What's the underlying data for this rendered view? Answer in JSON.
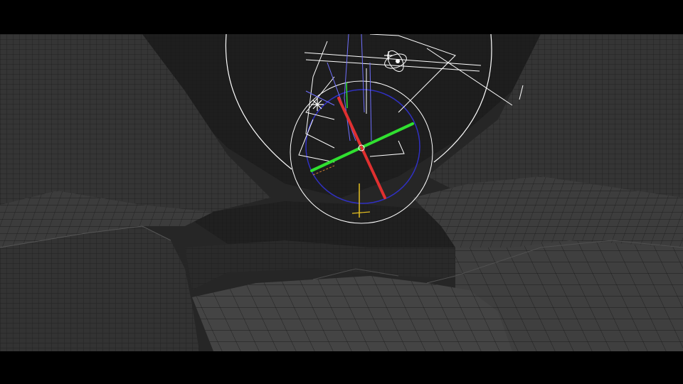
{
  "viewport": {
    "background": "#2b2b2b",
    "terrain_fill": "#3a3a3a",
    "terrain_fill_dark": "#242424",
    "wire_color": "#1a1a1a",
    "wire_light": "#4a4a4a"
  },
  "gizmo": {
    "x_axis_color": "#e03030",
    "y_axis_color": "#30e030",
    "z_axis_color": "#e6c020",
    "ring_color": "#ffffff",
    "inner_ring_color": "#3030c0",
    "helper_color": "#ffffff",
    "guide_color": "#7070ff"
  },
  "icons": {
    "light_a": "light-star-icon",
    "light_b": "light-star-icon",
    "orbit": "orbit-icon"
  }
}
